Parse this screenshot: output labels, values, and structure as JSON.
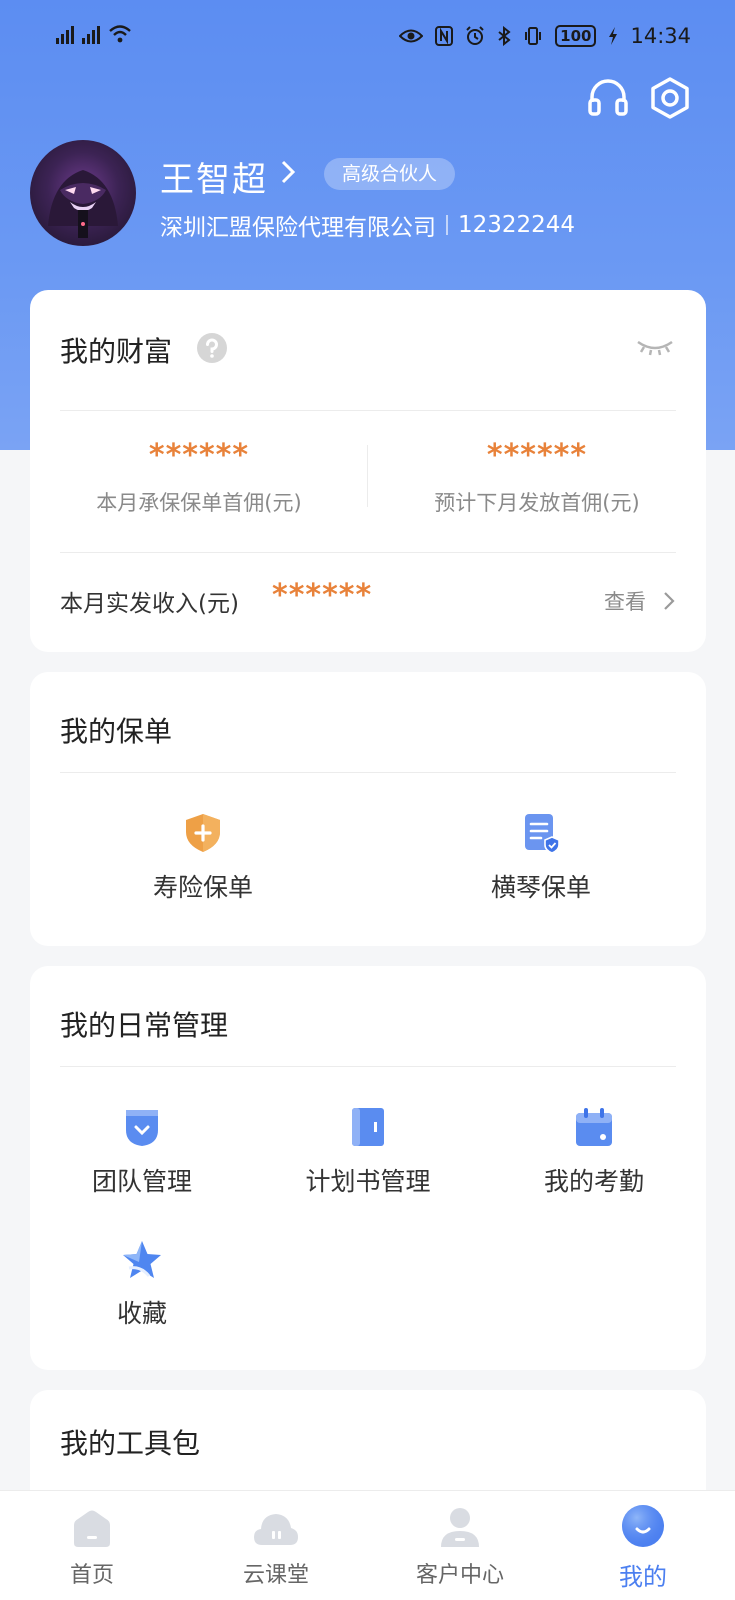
{
  "status_bar": {
    "time": "14:34",
    "battery": "100"
  },
  "profile": {
    "name": "王智超",
    "level_badge": "高级合伙人",
    "company": "深圳汇盟保险代理有限公司",
    "agent_id": "12322244"
  },
  "wealth": {
    "title": "我的财富",
    "this_month_commission_value": "******",
    "this_month_commission_label": "本月承保保单首佣(元)",
    "next_month_commission_value": "******",
    "next_month_commission_label": "预计下月发放首佣(元)",
    "actual_income_label": "本月实发收入(元)",
    "actual_income_value": "******",
    "view_label": "查看"
  },
  "policies": {
    "title": "我的保单",
    "items": [
      {
        "label": "寿险保单",
        "icon": "shield-plus-icon"
      },
      {
        "label": "横琴保单",
        "icon": "document-shield-icon"
      }
    ]
  },
  "daily": {
    "title": "我的日常管理",
    "items": [
      {
        "label": "团队管理",
        "icon": "team-pocket-icon"
      },
      {
        "label": "计划书管理",
        "icon": "plan-book-icon"
      },
      {
        "label": "我的考勤",
        "icon": "calendar-icon"
      },
      {
        "label": "收藏",
        "icon": "star-icon"
      }
    ]
  },
  "toolkit": {
    "title": "我的工具包"
  },
  "tabbar": {
    "items": [
      {
        "label": "首页",
        "icon": "home-icon"
      },
      {
        "label": "云课堂",
        "icon": "cloud-icon"
      },
      {
        "label": "客户中心",
        "icon": "person-icon"
      },
      {
        "label": "我的",
        "icon": "smile-icon"
      }
    ],
    "active_index": 3
  },
  "colors": {
    "primary": "#5c8df2",
    "accent_orange": "#e8823a",
    "active_tab": "#4b7ff0"
  }
}
